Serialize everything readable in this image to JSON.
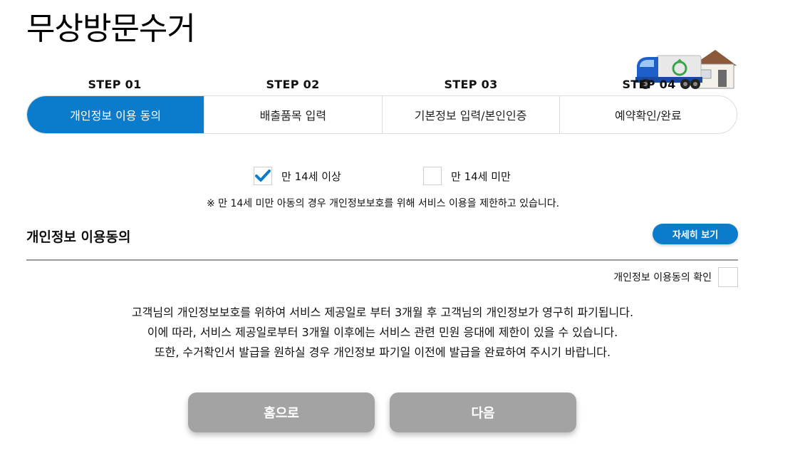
{
  "page": {
    "title": "무상방문수거"
  },
  "steps": [
    {
      "number": "STEP 01",
      "label": "개인정보 이용 동의",
      "active": true
    },
    {
      "number": "STEP 02",
      "label": "배출품목 입력",
      "active": false
    },
    {
      "number": "STEP 03",
      "label": "기본정보 입력/본인인증",
      "active": false
    },
    {
      "number": "STEP 04",
      "label": "예약확인/완료",
      "active": false
    }
  ],
  "age_options": [
    {
      "label": "만 14세 이상",
      "checked": true
    },
    {
      "label": "만 14세 미만",
      "checked": false
    }
  ],
  "notice": "※ 만 14세 미만 아동의 경우 개인정보보호를 위해 서비스 이용을 제한하고 있습니다.",
  "privacy": {
    "title": "개인정보 이용동의",
    "detail_button": "자세히 보기",
    "confirm_label": "개인정보 이용동의 확인",
    "confirm_checked": false
  },
  "body_lines": [
    "고객님의 개인정보보호를 위하여 서비스 제공일로 부터 3개월 후 고객님의 개인정보가 영구히 파기됩니다.",
    "이에 따라, 서비스 제공일로부터 3개월 이후에는 서비스 관련 민원 응대에 제한이 있을 수 있습니다.",
    "또한, 수거확인서 발급을 원하실 경우 개인정보 파기일 이전에 발급을 완료하여 주시기 바랍니다."
  ],
  "buttons": {
    "home": "홈으로",
    "next": "다음"
  },
  "colors": {
    "accent": "#0a7ccb",
    "disabled_button": "#a3a3a3",
    "check": "#0a7ccb"
  },
  "icons": {
    "truck": "recycling-truck-icon",
    "house": "house-icon",
    "check": "check-icon"
  }
}
